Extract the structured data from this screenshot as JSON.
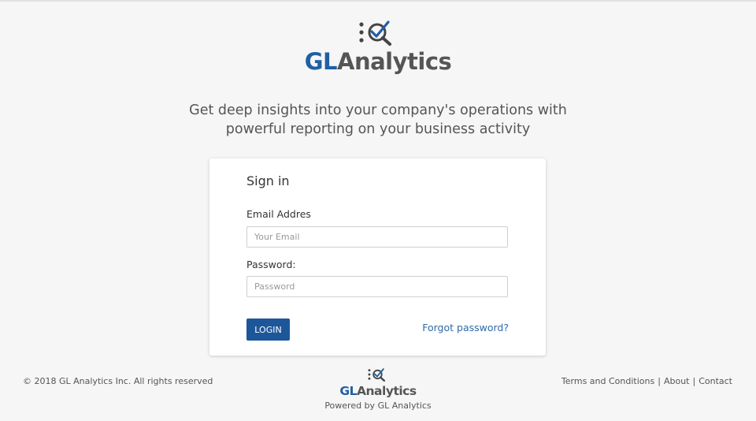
{
  "brand": {
    "gl": "GL",
    "rest": "Analytics",
    "accent_color": "#1f5fa5",
    "icon": "magnifier-check-icon"
  },
  "tagline": {
    "line1": "Get deep insights into your company's operations with",
    "line2": "powerful reporting on your business activity"
  },
  "signin": {
    "title": "Sign in",
    "email_label": "Email Addres",
    "email_placeholder": "Your Email",
    "email_value": "",
    "password_label": "Password:",
    "password_placeholder": "Password",
    "password_value": "",
    "login_label": "LOGIN",
    "login_color": "#1e5799",
    "forgot_label": "Forgot password?"
  },
  "footer": {
    "copyright": "© 2018 GL Analytics Inc. All rights reserved",
    "powered": "Powered by GL Analytics",
    "links": {
      "terms": "Terms and Conditions",
      "about": "About",
      "contact": "Contact",
      "separator": "|"
    }
  }
}
